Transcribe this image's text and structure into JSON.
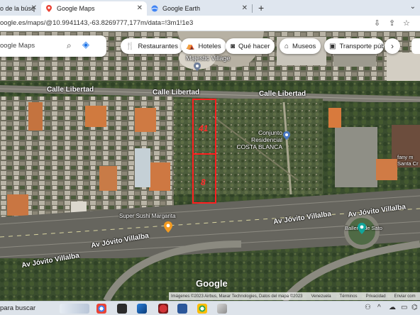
{
  "browser": {
    "tabs": [
      {
        "label": "o de la búsq"
      },
      {
        "label": "Google Maps"
      },
      {
        "label": "Google Earth"
      }
    ],
    "new_tab": "+",
    "url": "oogle.es/maps/@10.9941143,-63.8269777,177m/data=!3m1!1e3"
  },
  "maps": {
    "search_placeholder": "oogle Maps",
    "chips": [
      {
        "label": "Restaurantes",
        "icon": "fork-knife-icon"
      },
      {
        "label": "Hoteles",
        "icon": "bed-icon"
      },
      {
        "label": "Qué hacer",
        "icon": "camera-icon"
      },
      {
        "label": "Museos",
        "icon": "museum-icon"
      },
      {
        "label": "Transporte públi",
        "icon": "bus-icon"
      }
    ],
    "roads": {
      "calle_left": "Calle Libertad",
      "calle_mid": "Calle Libertad",
      "calle_right": "Calle Libertad",
      "av_1": "Av Jóvito Villalba",
      "av_2": "Av Jóvito Villalba",
      "av_3": "Av Jóvito Villalba",
      "av_4": "Av Jóvito Villalba"
    },
    "places": {
      "magestic": "Majestic Village",
      "conjunto": "Conjunto Residencial\nCOSTA BLANCA",
      "sushi": "Super Sushi Margarita",
      "ballena": "Ballena de Sato",
      "fanny": "fany m\nSanta Cr"
    },
    "plots": {
      "a": "41",
      "b": "8"
    },
    "logo": "Google",
    "attribution": {
      "imagery": "Imágenes ©2023 Airbus, Maxar Technologies, Datos del mapa ©2023",
      "country": "Venezuela",
      "terms": "Términos",
      "privacy": "Privacidad",
      "feedback": "Enviar com"
    }
  },
  "taskbar": {
    "search_text": "para buscar"
  }
}
